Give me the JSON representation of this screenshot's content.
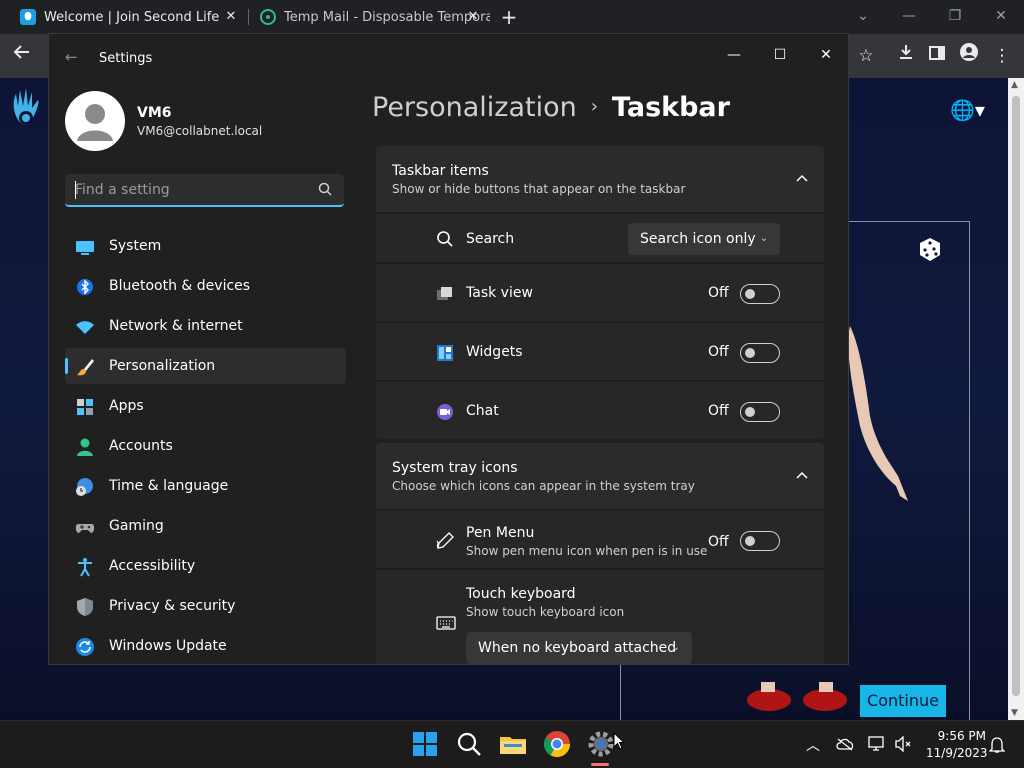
{
  "browser": {
    "tabs": [
      {
        "title": "Welcome | Join Second Life",
        "active": true
      },
      {
        "title": "Temp Mail - Disposable Tempora",
        "active": false
      }
    ],
    "new_tab_label": "+"
  },
  "webpage": {
    "continue_label": "Continue"
  },
  "settings": {
    "app_title": "Settings",
    "profile": {
      "name": "VM6",
      "email": "VM6@collabnet.local"
    },
    "search": {
      "placeholder": "Find a setting",
      "value": ""
    },
    "nav": [
      {
        "label": "System",
        "icon": "monitor-icon"
      },
      {
        "label": "Bluetooth & devices",
        "icon": "bluetooth-icon"
      },
      {
        "label": "Network & internet",
        "icon": "wifi-icon"
      },
      {
        "label": "Personalization",
        "icon": "brush-icon",
        "active": true
      },
      {
        "label": "Apps",
        "icon": "apps-icon"
      },
      {
        "label": "Accounts",
        "icon": "person-icon"
      },
      {
        "label": "Time & language",
        "icon": "globe-clock-icon"
      },
      {
        "label": "Gaming",
        "icon": "gamepad-icon"
      },
      {
        "label": "Accessibility",
        "icon": "accessibility-icon"
      },
      {
        "label": "Privacy & security",
        "icon": "shield-icon"
      },
      {
        "label": "Windows Update",
        "icon": "update-icon"
      }
    ],
    "breadcrumb": {
      "parent": "Personalization",
      "separator": "›",
      "current": "Taskbar"
    },
    "taskbar_items": {
      "title": "Taskbar items",
      "subtitle": "Show or hide buttons that appear on the taskbar",
      "search": {
        "label": "Search",
        "value": "Search icon only"
      },
      "task_view": {
        "label": "Task view",
        "state": "Off"
      },
      "widgets": {
        "label": "Widgets",
        "state": "Off"
      },
      "chat": {
        "label": "Chat",
        "state": "Off"
      }
    },
    "system_tray": {
      "title": "System tray icons",
      "subtitle": "Choose which icons can appear in the system tray",
      "pen_menu": {
        "label": "Pen Menu",
        "sub": "Show pen menu icon when pen is in use",
        "state": "Off"
      },
      "touch_keyboard": {
        "label": "Touch keyboard",
        "sub": "Show touch keyboard icon",
        "value": "When no keyboard attached"
      }
    }
  },
  "taskbar": {
    "time": "9:56 PM",
    "date": "11/9/2023"
  },
  "colors": {
    "accent": "#4cc2ff",
    "continue_button": "#18b6e8",
    "settings_bg": "#202020"
  }
}
